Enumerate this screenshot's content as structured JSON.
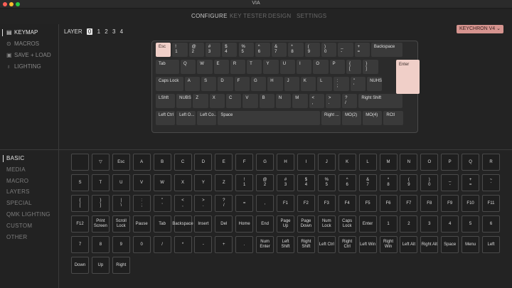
{
  "window": {
    "title": "VIA"
  },
  "nav": {
    "tabs": [
      "CONFIGURE",
      "KEY TESTER",
      "DESIGN",
      "SETTINGS"
    ],
    "active": 0
  },
  "sidebar": {
    "menu": [
      {
        "label": "KEYMAP",
        "icon": "keyboard-icon",
        "active": true
      },
      {
        "label": "MACROS",
        "icon": "macro-icon",
        "active": false
      },
      {
        "label": "SAVE + LOAD",
        "icon": "save-icon",
        "active": false
      },
      {
        "label": "LIGHTING",
        "icon": "bulb-icon",
        "active": false
      }
    ],
    "categories": [
      {
        "label": "BASIC",
        "active": true
      },
      {
        "label": "MEDIA",
        "active": false
      },
      {
        "label": "MACRO",
        "active": false
      },
      {
        "label": "LAYERS",
        "active": false
      },
      {
        "label": "SPECIAL",
        "active": false
      },
      {
        "label": "QMK LIGHTING",
        "active": false
      },
      {
        "label": "CUSTOM",
        "active": false
      },
      {
        "label": "OTHER",
        "active": false
      }
    ]
  },
  "layers": {
    "label": "LAYER",
    "items": [
      "0",
      "1",
      "2",
      "3",
      "4"
    ],
    "selected": "0"
  },
  "keyboard_selector": {
    "label": "KEYCHRON V4",
    "icon": "chevron-down-icon"
  },
  "keyboard": {
    "rows": [
      [
        "Esc",
        "!\n1",
        "@\n2",
        "#\n3",
        "$\n4",
        "%\n5",
        "^\n6",
        "&\n7",
        "*\n8",
        "(\n9",
        ")\n0",
        "_\n-",
        "+\n=",
        "Backspace"
      ],
      [
        "Tab",
        "Q",
        "W",
        "E",
        "R",
        "T",
        "Y",
        "U",
        "I",
        "O",
        "P",
        "{\n[",
        "}\n]"
      ],
      [
        "Caps Lock",
        "A",
        "S",
        "D",
        "F",
        "G",
        "H",
        "J",
        "K",
        "L",
        ":\n;",
        "\"\n'",
        "NUHS"
      ],
      [
        "LShft",
        "NUBS",
        "Z",
        "X",
        "C",
        "V",
        "B",
        "N",
        "M",
        "<\n,",
        ">\n.",
        "?\n/",
        "Right Shift"
      ],
      [
        "Left Ctrl",
        "Left O...",
        "Left Co...",
        "Space",
        "Right ...",
        "MO(2)",
        "MO(4)",
        "RCtl"
      ]
    ],
    "enter": "Enter"
  },
  "palette": {
    "rows": [
      [
        "",
        "▽",
        "Esc",
        "A",
        "B",
        "C",
        "D",
        "E",
        "F",
        "G",
        "H",
        "I",
        "J",
        "K",
        "L",
        "M",
        "N",
        "O",
        "P",
        "Q",
        "R"
      ],
      [
        "S",
        "T",
        "U",
        "V",
        "W",
        "X",
        "Y",
        "Z",
        "!\n1",
        "@\n2",
        "#\n3",
        "$\n4",
        "%\n5",
        "^\n6",
        "&\n7",
        "*\n8",
        "(\n9",
        ")\n0",
        "_\n-",
        "+\n=",
        "~\n`"
      ],
      [
        "{\n[",
        "}\n]",
        "|\n\\",
        ":\n;",
        "\"\n'",
        "<\n,",
        ">\n.",
        "?\n/",
        "=",
        ",",
        "F1",
        "F2",
        "F3",
        "F4",
        "F5",
        "F6",
        "F7",
        "F8",
        "F9",
        "F10",
        "F11"
      ],
      [
        "F12",
        "Print\nScreen",
        "Scroll\nLock",
        "Pause",
        "Tab",
        "Backspace",
        "Insert",
        "Del",
        "Home",
        "End",
        "Page Up",
        "Page\nDown",
        "Num\nLock",
        "Caps\nLock",
        "Enter",
        "1",
        "2",
        "3",
        "4",
        "5",
        "6"
      ],
      [
        "7",
        "8",
        "9",
        "0",
        "/",
        "*",
        "-",
        "+",
        ".",
        "Num\nEnter",
        "Left\nShift",
        "Right\nShift",
        "Left Ctrl",
        "Right\nCtrl",
        "Left Win",
        "Right\nWin",
        "Left Alt",
        "Right Alt",
        "Space",
        "Menu",
        "Left"
      ],
      [
        "Down",
        "Up",
        "Right"
      ]
    ]
  },
  "colors": {
    "accent": "#f0cfc8",
    "selector": "#d6948f",
    "bg": "#232323"
  }
}
